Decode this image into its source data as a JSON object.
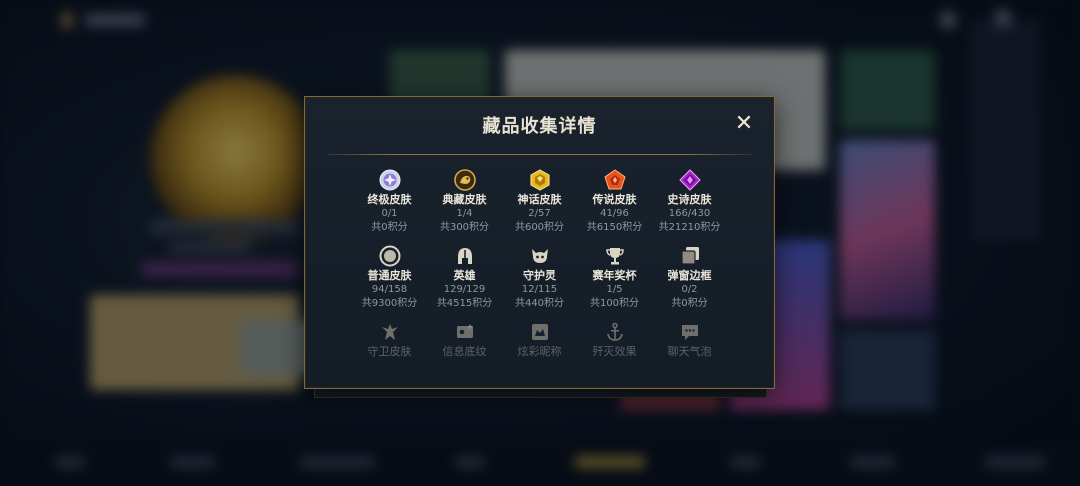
{
  "dialog": {
    "title": "藏品收集详情",
    "close_label": "✕"
  },
  "rows": [
    [
      {
        "label": "终极皮肤",
        "count": "0/1",
        "points": "共0积分",
        "icon": "ultimate-gem-icon"
      },
      {
        "label": "典藏皮肤",
        "count": "1/4",
        "points": "共300积分",
        "icon": "prestige-emblem-icon"
      },
      {
        "label": "神话皮肤",
        "count": "2/57",
        "points": "共600积分",
        "icon": "mythic-gem-icon"
      },
      {
        "label": "传说皮肤",
        "count": "41/96",
        "points": "共6150积分",
        "icon": "legendary-gem-icon"
      },
      {
        "label": "史诗皮肤",
        "count": "166/430",
        "points": "共21210积分",
        "icon": "epic-gem-icon"
      }
    ],
    [
      {
        "label": "普通皮肤",
        "count": "94/158",
        "points": "共9300积分",
        "icon": "standard-gem-icon"
      },
      {
        "label": "英雄",
        "count": "129/129",
        "points": "共4515积分",
        "icon": "helmet-icon"
      },
      {
        "label": "守护灵",
        "count": "12/115",
        "points": "共440积分",
        "icon": "little-legend-icon"
      },
      {
        "label": "赛年奖杯",
        "count": "1/5",
        "points": "共100积分",
        "icon": "trophy-icon"
      },
      {
        "label": "弹窗边框",
        "count": "0/2",
        "points": "共0积分",
        "icon": "frame-icon"
      }
    ],
    [
      {
        "label": "守卫皮肤",
        "icon": "ward-icon"
      },
      {
        "label": "信息底纹",
        "icon": "banner-icon"
      },
      {
        "label": "炫彩昵称",
        "icon": "nameplate-icon"
      },
      {
        "label": "歼灭效果",
        "icon": "anchor-icon"
      },
      {
        "label": "聊天气泡",
        "icon": "chat-bubble-icon"
      }
    ]
  ]
}
